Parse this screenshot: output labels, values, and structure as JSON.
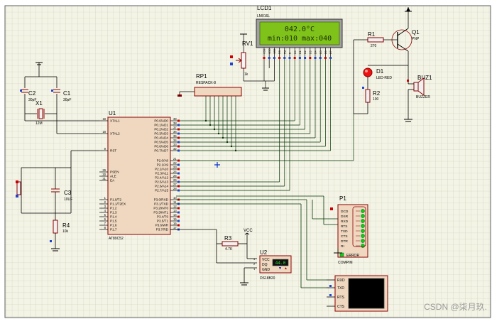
{
  "lcd": {
    "ref": "LCD1",
    "part": "LM016L",
    "line1": "042.0°C",
    "line2": "min:010  max:040",
    "pins": [
      "VSS",
      "VDD",
      "VEE",
      "RS",
      "RW",
      "E",
      "D0",
      "D1",
      "D2",
      "D3",
      "D4",
      "D5",
      "D6",
      "D7"
    ]
  },
  "rv1": {
    "ref": "RV1",
    "value": "1k"
  },
  "rp1": {
    "ref": "RP1",
    "part": "RESPACK-8"
  },
  "u1": {
    "ref": "U1",
    "part": "AT89C52",
    "left_pins": [
      {
        "num": "19",
        "name": "XTAL1"
      },
      {
        "num": "18",
        "name": "XTAL2"
      },
      {
        "num": "9",
        "name": "RST"
      },
      {
        "num": "29",
        "name": "PSEN"
      },
      {
        "num": "30",
        "name": "ALE"
      },
      {
        "num": "31",
        "name": "EA"
      },
      {
        "num": "1",
        "name": "P1.0/T2"
      },
      {
        "num": "2",
        "name": "P1.1/T2EX"
      },
      {
        "num": "3",
        "name": "P1.2"
      },
      {
        "num": "4",
        "name": "P1.3"
      },
      {
        "num": "5",
        "name": "P1.4"
      },
      {
        "num": "6",
        "name": "P1.5"
      },
      {
        "num": "7",
        "name": "P1.6"
      },
      {
        "num": "8",
        "name": "P1.7"
      }
    ],
    "right_pins": [
      {
        "num": "39",
        "name": "P0.0/AD0"
      },
      {
        "num": "38",
        "name": "P0.1/AD1"
      },
      {
        "num": "37",
        "name": "P0.2/AD2"
      },
      {
        "num": "36",
        "name": "P0.3/AD3"
      },
      {
        "num": "35",
        "name": "P0.4/AD4"
      },
      {
        "num": "34",
        "name": "P0.5/AD5"
      },
      {
        "num": "33",
        "name": "P0.6/AD6"
      },
      {
        "num": "32",
        "name": "P0.7/AD7"
      },
      {
        "num": "21",
        "name": "P2.0/A8"
      },
      {
        "num": "22",
        "name": "P2.1/A9"
      },
      {
        "num": "23",
        "name": "P2.2/A10"
      },
      {
        "num": "24",
        "name": "P2.3/A11"
      },
      {
        "num": "25",
        "name": "P2.4/A12"
      },
      {
        "num": "26",
        "name": "P2.5/A13"
      },
      {
        "num": "27",
        "name": "P2.6/A14"
      },
      {
        "num": "28",
        "name": "P2.7/A15"
      },
      {
        "num": "10",
        "name": "P3.0/RXD"
      },
      {
        "num": "11",
        "name": "P3.1/TXD"
      },
      {
        "num": "12",
        "name": "P3.2/INT0"
      },
      {
        "num": "13",
        "name": "P3.3/INT1"
      },
      {
        "num": "14",
        "name": "P3.4/T0"
      },
      {
        "num": "15",
        "name": "P3.5/T1"
      },
      {
        "num": "16",
        "name": "P3.6/WR"
      },
      {
        "num": "17",
        "name": "P3.7/RD"
      }
    ]
  },
  "c1": {
    "ref": "C1",
    "value": "30pF"
  },
  "c2": {
    "ref": "C2",
    "value": "30pF"
  },
  "x1": {
    "ref": "X1",
    "value": "12M"
  },
  "c3": {
    "ref": "C3",
    "value": "10UF"
  },
  "r4": {
    "ref": "R4",
    "value": "10k"
  },
  "r1": {
    "ref": "R1",
    "value": "270"
  },
  "q1": {
    "ref": "Q1",
    "part": "PNP"
  },
  "d1": {
    "ref": "D1",
    "part": "LED-RED"
  },
  "r2": {
    "ref": "R2",
    "value": "100"
  },
  "buz1": {
    "ref": "BUZ1",
    "part": "BUZZER"
  },
  "r3": {
    "ref": "R3",
    "value": "4.7K"
  },
  "vcc": {
    "label": "VCC"
  },
  "u2": {
    "ref": "U2",
    "part": "DS18B20",
    "pins": [
      "VCC",
      "DQ",
      "GND"
    ],
    "pin_nums": [
      "3",
      "2",
      "1"
    ],
    "reading": "44.0"
  },
  "p1": {
    "ref": "P1",
    "part": "COMPIM",
    "pins": [
      "DCD",
      "DSR",
      "RXD",
      "RTS",
      "TXD",
      "CTS",
      "DTR",
      "RI"
    ],
    "error_label": "ERROR"
  },
  "vterm": {
    "pins": [
      "RXD",
      "TXD",
      "RTS",
      "CTS"
    ]
  },
  "watermark": "CSDN @柒月玖."
}
